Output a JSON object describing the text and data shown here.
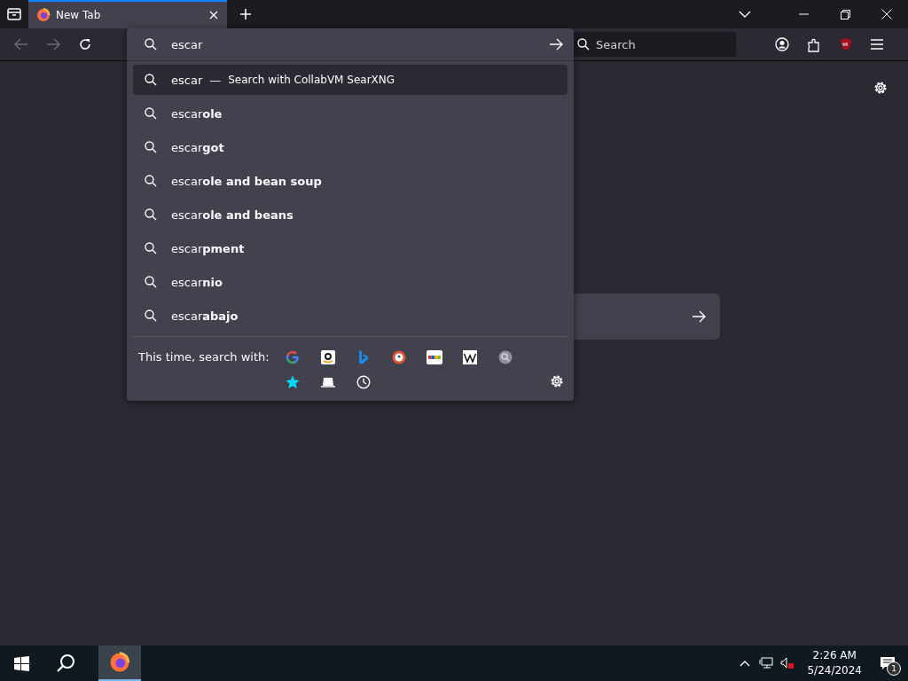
{
  "tab": {
    "title": "New Tab",
    "selected": true
  },
  "urlbar": {
    "value": "escar"
  },
  "search_field": {
    "placeholder": "Search"
  },
  "suggestions": [
    {
      "text": "escar",
      "action": "Search with CollabVM SearXNG",
      "separator": "—",
      "selected": true
    },
    {
      "text": "escar**ole**",
      "selected": false
    },
    {
      "text": "escar**got**",
      "selected": false
    },
    {
      "text": "escar**ole and bean soup**",
      "selected": false
    },
    {
      "text": "escar**ole and beans**",
      "selected": false
    },
    {
      "text": "escar**pment**",
      "selected": false
    },
    {
      "text": "escar**nio**",
      "selected": false
    },
    {
      "text": "escar**abajo**",
      "selected": false
    }
  ],
  "search_with": {
    "label": "This time, search with:"
  },
  "taskbar": {
    "time": "2:26 AM",
    "date": "5/24/2024",
    "notifications": "1"
  }
}
